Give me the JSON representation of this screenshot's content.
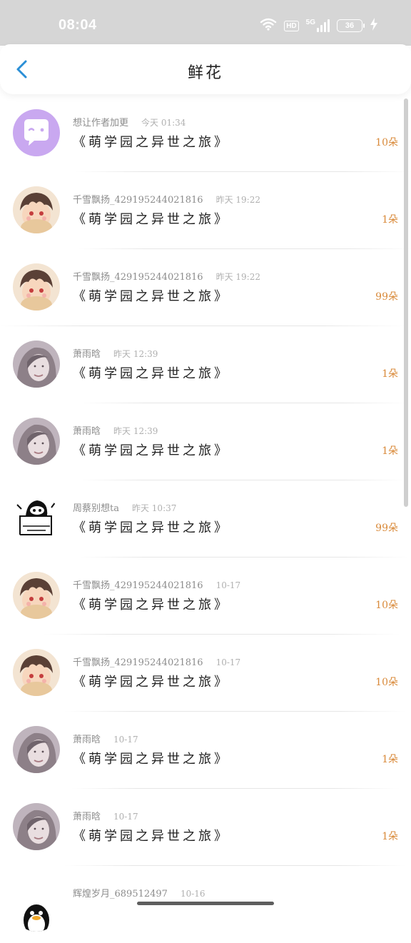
{
  "status_bar": {
    "time": "08:04",
    "network_badge": "HD",
    "signal_label": "5G",
    "battery_level": "36",
    "icons": [
      "wifi-icon",
      "hd-badge",
      "signal-icon",
      "battery-icon",
      "charging-icon"
    ]
  },
  "header": {
    "title": "鲜花",
    "back_icon": "chevron-left-icon",
    "accent_color": "#2b8fd6"
  },
  "colors": {
    "count_color": "#d98a3a",
    "meta_color": "#8c8c8c",
    "avatar_purple": "#c9a8f0"
  },
  "items": [
    {
      "user": "想让作者加更",
      "time": "今天 01:34",
      "book": "《萌学园之异世之旅》",
      "count": "10朵",
      "avatar": "bubble-avatar"
    },
    {
      "user": "千雪飘扬_429195244021816",
      "time": "昨天 19:22",
      "book": "《萌学园之异世之旅》",
      "count": "1朵",
      "avatar": "anime-boy-avatar"
    },
    {
      "user": "千雪飘扬_429195244021816",
      "time": "昨天 19:22",
      "book": "《萌学园之异世之旅》",
      "count": "99朵",
      "avatar": "anime-boy-avatar"
    },
    {
      "user": "萧雨晗",
      "time": "昨天 12:39",
      "book": "《萌学园之异世之旅》",
      "count": "1朵",
      "avatar": "girl-photo-avatar"
    },
    {
      "user": "萧雨晗",
      "time": "昨天 12:39",
      "book": "《萌学园之异世之旅》",
      "count": "1朵",
      "avatar": "girl-photo-avatar"
    },
    {
      "user": "周蔡别想ta",
      "time": "昨天 10:37",
      "book": "《萌学园之异世之旅》",
      "count": "99朵",
      "avatar": "cartoon-sketch-avatar"
    },
    {
      "user": "千雪飘扬_429195244021816",
      "time": "10-17",
      "book": "《萌学园之异世之旅》",
      "count": "10朵",
      "avatar": "anime-boy-avatar"
    },
    {
      "user": "千雪飘扬_429195244021816",
      "time": "10-17",
      "book": "《萌学园之异世之旅》",
      "count": "10朵",
      "avatar": "anime-boy-avatar"
    },
    {
      "user": "萧雨晗",
      "time": "10-17",
      "book": "《萌学园之异世之旅》",
      "count": "1朵",
      "avatar": "girl-photo-avatar"
    },
    {
      "user": "萧雨晗",
      "time": "10-17",
      "book": "《萌学园之异世之旅》",
      "count": "1朵",
      "avatar": "girl-photo-avatar"
    },
    {
      "user": "辉煌岁月_689512497",
      "time": "10-16",
      "book": "",
      "count": "",
      "avatar": "penguin-avatar"
    }
  ]
}
